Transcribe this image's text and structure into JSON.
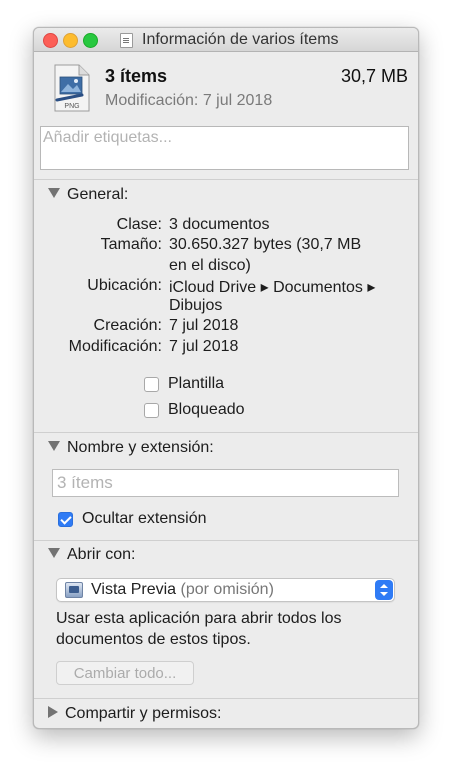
{
  "window": {
    "title": "Información de varios ítems"
  },
  "header": {
    "name": "3 ítems",
    "size": "30,7 MB",
    "modified": "Modificación: 7 jul 2018",
    "icon_label": "PNG"
  },
  "tags": {
    "placeholder": "Añadir etiquetas..."
  },
  "general": {
    "heading": "General:",
    "rows": [
      {
        "label": "Clase:",
        "value": "3 documentos"
      },
      {
        "label": "Tamaño:",
        "value": "30.650.327 bytes (30,7 MB",
        "value_cont": "en el disco)"
      },
      {
        "label": "Ubicación:",
        "value": "iCloud Drive ▸ Documentos ▸",
        "value_cont": "Dibujos"
      },
      {
        "label": "Creación:",
        "value": "7 jul 2018"
      },
      {
        "label": "Modificación:",
        "value": "7 jul 2018"
      }
    ],
    "template_label": "Plantilla",
    "template_checked": false,
    "locked_label": "Bloqueado",
    "locked_checked": false
  },
  "name_ext": {
    "heading": "Nombre y extensión:",
    "name_placeholder": "3 ítems",
    "hide_ext_label": "Ocultar extensión",
    "hide_ext_checked": true
  },
  "open_with": {
    "heading": "Abrir con:",
    "app_name": "Vista Previa",
    "app_default": "(por omisión)",
    "description": "Usar esta aplicación para abrir todos los documentos de estos tipos.",
    "change_all_label": "Cambiar todo..."
  },
  "sharing": {
    "heading": "Compartir y permisos:"
  },
  "colors": {
    "accent": "#2f7bf5",
    "window_bg": "#ececec"
  }
}
